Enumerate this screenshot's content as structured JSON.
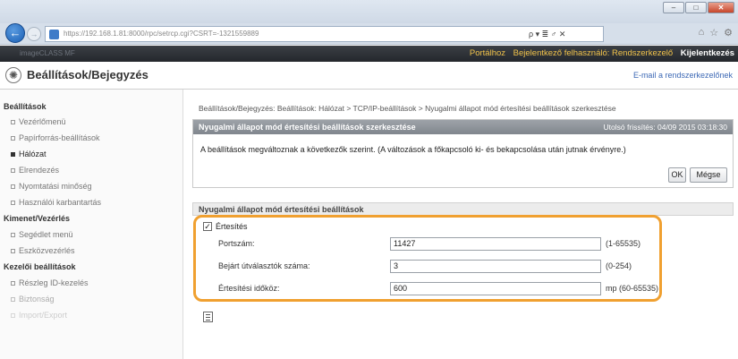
{
  "browser": {
    "url": "https://192.168.1.81:8000/rpc/setrcp.cgi?CSRT=-1321559889",
    "search_glyph": "ρ ▾ ≣ ♂ ✕"
  },
  "appbar": {
    "brand": "imageCLASS MF",
    "portal_link": "Portálhoz",
    "user_label": "Bejelentkező felhasználó: Rendszerkezelő",
    "logout": "Kijelentkezés"
  },
  "header": {
    "title": "Beállítások/Bejegyzés",
    "email_link": "E-mail a rendszerkezelőnek"
  },
  "sidebar": {
    "sections": [
      {
        "title": "Beállítások",
        "items": [
          "Vezérlőmenü",
          "Papírforrás-beállítások",
          "Hálózat",
          "Elrendezés",
          "Nyomtatási minőség",
          "Használói karbantartás"
        ]
      },
      {
        "title": "Kimenet/Vezérlés",
        "items": [
          "Segédlet menü",
          "Eszközvezérlés"
        ]
      },
      {
        "title": "Kezelői beállítások",
        "items": [
          "Részleg ID-kezelés",
          "Biztonság",
          "Import/Export"
        ]
      }
    ],
    "active": "Hálózat"
  },
  "main": {
    "breadcrumb": "Beállítások/Bejegyzés: Beállítások: Hálózat > TCP/IP-beállítások > Nyugalmi állapot mód értesítési beállítások szerkesztése",
    "panel_title": "Nyugalmi állapot mód értesítési beállítások szerkesztése",
    "last_updated": "Utolsó frissítés: 04/09 2015 03:18:30",
    "notice": "A beállítások megváltoznak a következők szerint. (A változások a főkapcsoló ki- és bekapcsolása után jutnak érvényre.)",
    "ok_label": "OK",
    "cancel_label": "Mégse",
    "section_title": "Nyugalmi állapot mód értesítési beállítások",
    "checkbox_label": "Értesítés",
    "fields": [
      {
        "label": "Portszám:",
        "value": "11427",
        "range": "(1-65535)"
      },
      {
        "label": "Bejárt útválasztók száma:",
        "value": "3",
        "range": "(0-254)"
      },
      {
        "label": "Értesítési időköz:",
        "value": "600",
        "range": "mp (60-65535)"
      }
    ]
  }
}
